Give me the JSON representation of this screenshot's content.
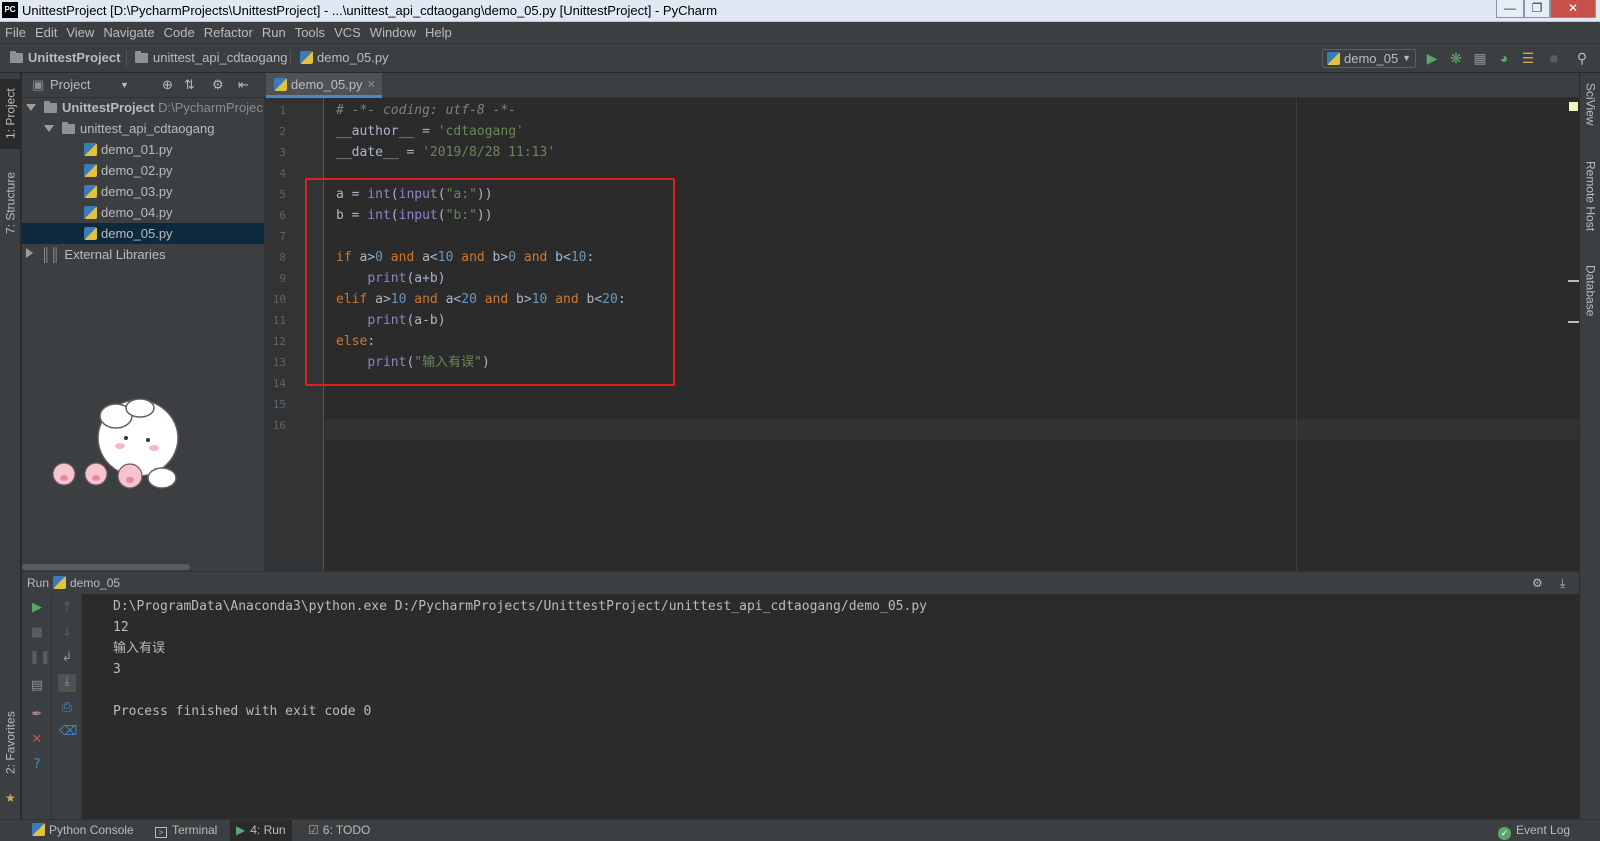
{
  "window": {
    "title": "UnittestProject [D:\\PycharmProjects\\UnittestProject] - ...\\unittest_api_cdtaogang\\demo_05.py [UnittestProject] - PyCharm",
    "app_icon": "PC"
  },
  "menu": [
    "File",
    "Edit",
    "View",
    "Navigate",
    "Code",
    "Refactor",
    "Run",
    "Tools",
    "VCS",
    "Window",
    "Help"
  ],
  "breadcrumb": [
    "UnittestProject",
    "unittest_api_cdtaogang",
    "demo_05.py"
  ],
  "run_config": "demo_05",
  "left_tabs": {
    "project": "1: Project",
    "structure": "7: Structure",
    "favorites": "2: Favorites"
  },
  "right_tabs": {
    "sciview": "SciView",
    "remote": "Remote Host",
    "database": "Database"
  },
  "project_panel": {
    "title": "Project",
    "root": {
      "name": "UnittestProject",
      "path": "D:\\PycharmProjec"
    },
    "folder": "unittest_api_cdtaogang",
    "files": [
      "demo_01.py",
      "demo_02.py",
      "demo_03.py",
      "demo_04.py",
      "demo_05.py"
    ],
    "selected": "demo_05.py",
    "external": "External Libraries"
  },
  "editor": {
    "tab": "demo_05.py",
    "line_numbers": [
      "1",
      "2",
      "3",
      "4",
      "5",
      "6",
      "7",
      "8",
      "9",
      "10",
      "11",
      "12",
      "13",
      "14",
      "15",
      "16"
    ],
    "lines": [
      "# -*- coding: utf-8 -*-",
      "__author__ = 'cdtaogang'",
      "__date__ = '2019/8/28 11:13'",
      "",
      "a = int(input(\"a:\"))",
      "b = int(input(\"b:\"))",
      "",
      "if a>0 and a<10 and b>0 and b<10:",
      "    print(a+b)",
      "elif a>10 and a<20 and b>10 and b<20:",
      "    print(a-b)",
      "else:",
      "    print(\"输入有误\")",
      "",
      "",
      ""
    ]
  },
  "run_panel": {
    "label": "Run",
    "config": "demo_05",
    "output": [
      "D:\\ProgramData\\Anaconda3\\python.exe D:/PycharmProjects/UnittestProject/unittest_api_cdtaogang/demo_05.py",
      "12",
      "输入有误",
      "3",
      "",
      "Process finished with exit code 0"
    ]
  },
  "status_bar": {
    "python_console": "Python Console",
    "terminal": "Terminal",
    "run": "4: Run",
    "todo": "6: TODO",
    "event_log": "Event Log"
  },
  "colors": {
    "keyword": "#cc7832",
    "string": "#6a8759",
    "builtin": "#8888c6",
    "number": "#6897bb",
    "comment": "#808080",
    "highlight_box": "#e01f1f",
    "run_green": "#59a869"
  }
}
